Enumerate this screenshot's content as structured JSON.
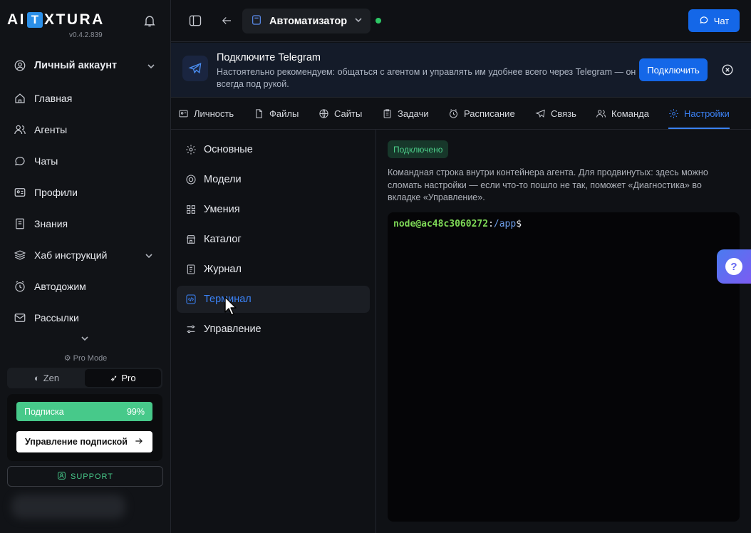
{
  "sidebar": {
    "logo_left": "AI",
    "logo_box": "T",
    "logo_right": "XTURA",
    "version": "v0.4.2.839",
    "account_label": "Личный аккаунт",
    "items": [
      {
        "label": "Главная",
        "icon": "home-icon"
      },
      {
        "label": "Агенты",
        "icon": "users-icon"
      },
      {
        "label": "Чаты",
        "icon": "chat-icon"
      },
      {
        "label": "Профили",
        "icon": "id-card-icon"
      },
      {
        "label": "Знания",
        "icon": "book-icon"
      },
      {
        "label": "Хаб инструкций",
        "icon": "stack-icon"
      },
      {
        "label": "Автодожим",
        "icon": "clock-icon"
      },
      {
        "label": "Рассылки",
        "icon": "mail-icon"
      }
    ],
    "pro_mode_label": "Pro Mode",
    "mode_options": [
      "Zen",
      "Pro"
    ],
    "mode_selected": "Pro",
    "subscription_label": "Подписка",
    "subscription_percent": "99%",
    "subscription_fraction": 0.99,
    "manage_subscription": "Управление подпиской",
    "support_label": "SUPPORT"
  },
  "topbar": {
    "agent_name": "Автоматизатор",
    "status": "online",
    "chat_button": "Чат"
  },
  "banner": {
    "title": "Подключите Telegram",
    "text": "Настоятельно рекомендуем: общаться с агентом и управлять им удобнее всего через Telegram — он всегда под рукой.",
    "connect_button": "Подключить"
  },
  "tabs": [
    {
      "label": "Личность",
      "icon": "persona-icon"
    },
    {
      "label": "Файлы",
      "icon": "files-icon"
    },
    {
      "label": "Сайты",
      "icon": "globe-icon"
    },
    {
      "label": "Задачи",
      "icon": "tasks-icon"
    },
    {
      "label": "Расписание",
      "icon": "alarm-icon"
    },
    {
      "label": "Связь",
      "icon": "send-icon"
    },
    {
      "label": "Команда",
      "icon": "team-icon"
    },
    {
      "label": "Настройки",
      "icon": "gear-icon"
    }
  ],
  "active_tab": "Настройки",
  "settings_menu": [
    {
      "label": "Основные",
      "icon": "gear-icon"
    },
    {
      "label": "Модели",
      "icon": "model-icon"
    },
    {
      "label": "Умения",
      "icon": "grid-icon"
    },
    {
      "label": "Каталог",
      "icon": "store-icon"
    },
    {
      "label": "Журнал",
      "icon": "log-icon"
    },
    {
      "label": "Терминал",
      "icon": "terminal-icon"
    },
    {
      "label": "Управление",
      "icon": "sliders-icon"
    }
  ],
  "active_setting": "Терминал",
  "terminal": {
    "status_badge": "Подключено",
    "description": "Командная строка внутри контейнера агента. Для продвинутых: здесь можно сломать настройки — если что-то пошло не так, поможет «Диагностика» во вкладке «Управление».",
    "prompt_user": "node@ac48c3060272",
    "prompt_sep": ":",
    "prompt_path": "/app",
    "prompt_sign": "$"
  },
  "help_button": "?",
  "colors": {
    "accent": "#1467e8",
    "active_text": "#3b82f6",
    "success": "#47c98a",
    "online": "#2ec866"
  }
}
